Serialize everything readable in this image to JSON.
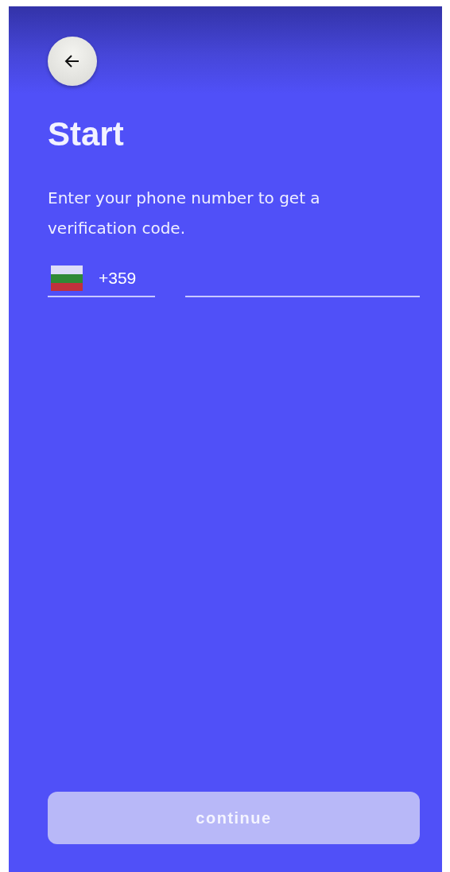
{
  "title": "Start",
  "subtitle": "Enter your phone number to get a verification code.",
  "phone": {
    "country_code": "+359"
  },
  "continue_button": {
    "label": "continue",
    "disabled": true
  }
}
